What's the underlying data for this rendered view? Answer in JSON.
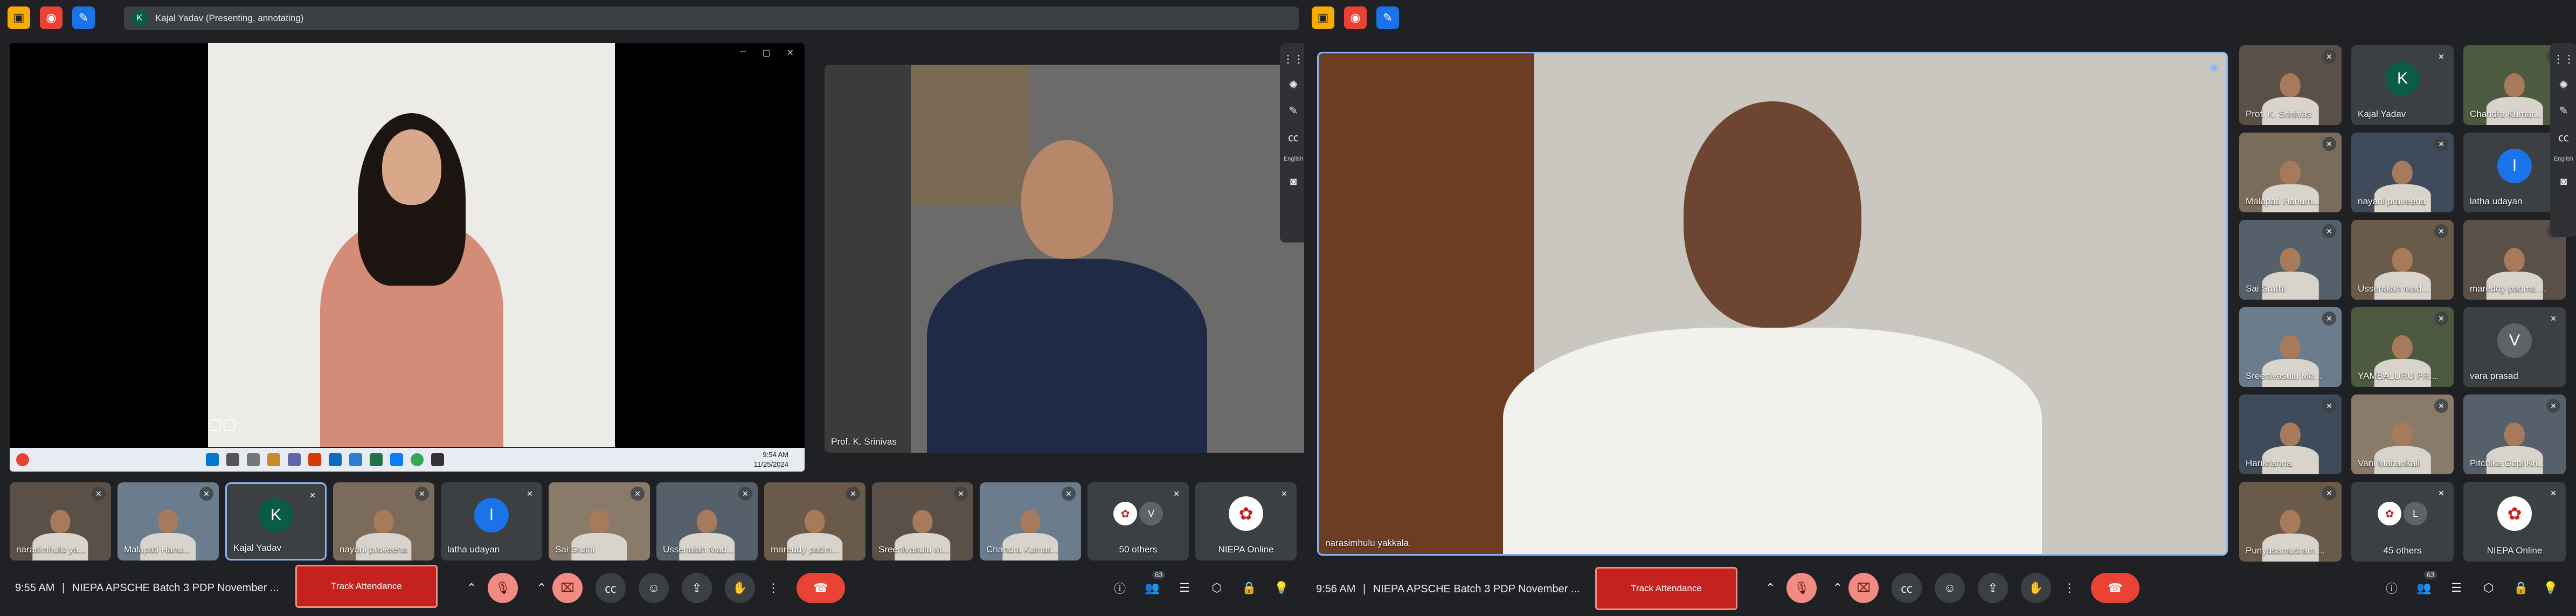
{
  "left": {
    "presenting_label": "Kajal Yadav (Presenting, annotating)",
    "presenter_initial": "K",
    "main_speaker_name": "Prof. K. Srinivas",
    "taskbar": {
      "time": "9:54 AM",
      "date": "11/25/2024"
    },
    "filmstrip": [
      {
        "name": "narasimhulu ya...",
        "type": "photo"
      },
      {
        "name": "Malapati Hanu...",
        "type": "photo"
      },
      {
        "name": "Kajal Yadav",
        "type": "avatar",
        "initial": "K"
      },
      {
        "name": "nayani praveena",
        "type": "photo"
      },
      {
        "name": "latha udayan",
        "type": "avatar",
        "initial": "l"
      },
      {
        "name": "Sai Sruthi",
        "type": "photo"
      },
      {
        "name": "Ussenaiah Mad...",
        "type": "photo"
      },
      {
        "name": "mareddy padm...",
        "type": "photo"
      },
      {
        "name": "Sreenivasulu M...",
        "type": "photo"
      },
      {
        "name": "Chandra Kumar...",
        "type": "photo"
      },
      {
        "name": "50 others",
        "type": "others",
        "initial": "V"
      },
      {
        "name": "NIEPA Online",
        "type": "logo"
      }
    ],
    "clock": "9:55 AM",
    "meeting_title": "NIEPA APSCHE Batch 3 PDP November ...",
    "track_label": "Track Attendance",
    "people_count": "63"
  },
  "right": {
    "main_speaker_name": "narasimhulu yakkala",
    "grid": [
      {
        "name": "Prof. K. Srinivas",
        "type": "photo"
      },
      {
        "name": "Kajal Yadav",
        "type": "avatar",
        "initial": "K"
      },
      {
        "name": "Chandra Kumar...",
        "type": "photo"
      },
      {
        "name": "Malapati Hanum...",
        "type": "photo"
      },
      {
        "name": "nayani praveena",
        "type": "photo"
      },
      {
        "name": "latha udayan",
        "type": "avatar",
        "initial": "l"
      },
      {
        "name": "Sai Sruthi",
        "type": "photo"
      },
      {
        "name": "Ussenaiah Mad...",
        "type": "photo"
      },
      {
        "name": "mareddy padma ...",
        "type": "photo"
      },
      {
        "name": "Sreenivasulu Me...",
        "type": "photo"
      },
      {
        "name": "YAMBALURU PR...",
        "type": "photo"
      },
      {
        "name": "vara prasad",
        "type": "avatar",
        "initial": "V"
      },
      {
        "name": "Harikrishna",
        "type": "photo"
      },
      {
        "name": "Vani Mahankali",
        "type": "photo"
      },
      {
        "name": "Pitchika Gopi Kri...",
        "type": "photo"
      },
      {
        "name": "Punyasamudram ...",
        "type": "photo"
      },
      {
        "name": "45 others",
        "type": "others",
        "initial": "L"
      },
      {
        "name": "NIEPA Online",
        "type": "logo"
      }
    ],
    "clock": "9:56 AM",
    "meeting_title": "NIEPA APSCHE Batch 3 PDP November ...",
    "track_label": "Track Attendance",
    "people_count": "63"
  },
  "side_tools": {
    "cc_label": "English"
  },
  "colors": {
    "bg": "#202124",
    "tile": "#3c4043",
    "danger": "#ea4335",
    "accent": "#1a73e8",
    "active_border": "#8ab4f8"
  }
}
